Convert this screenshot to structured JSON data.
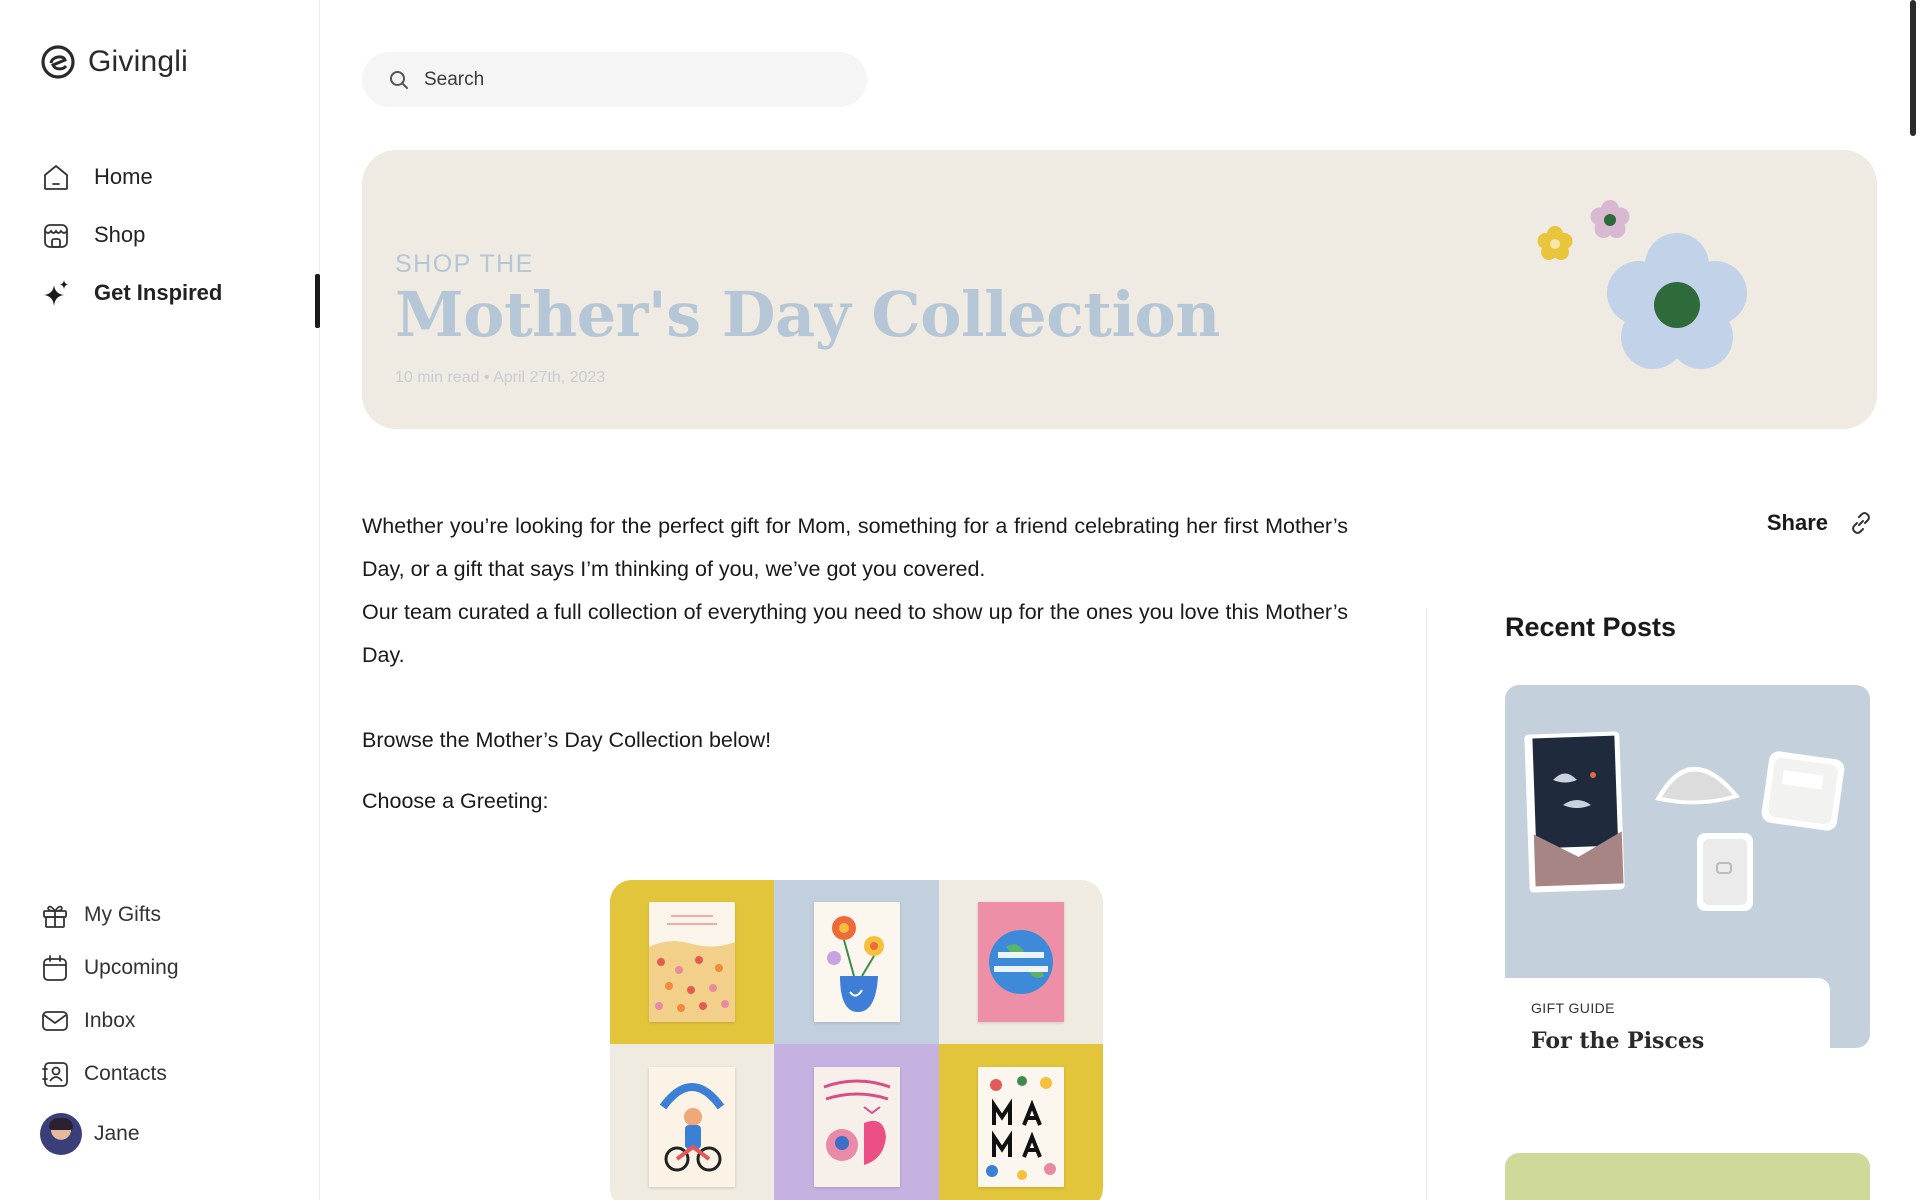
{
  "app": {
    "name": "Givingli"
  },
  "nav": {
    "items": [
      {
        "label": "Home",
        "icon": "home-icon"
      },
      {
        "label": "Shop",
        "icon": "shop-icon"
      },
      {
        "label": "Get Inspired",
        "icon": "sparkle-icon",
        "active": true
      }
    ]
  },
  "nav_bottom": {
    "items": [
      {
        "label": "My Gifts",
        "icon": "gift-icon"
      },
      {
        "label": "Upcoming",
        "icon": "calendar-icon"
      },
      {
        "label": "Inbox",
        "icon": "mail-icon"
      },
      {
        "label": "Contacts",
        "icon": "contacts-icon"
      }
    ]
  },
  "user": {
    "name": "Jane"
  },
  "search": {
    "placeholder": "Search"
  },
  "hero": {
    "kicker": "SHOP THE",
    "title": "Mother's Day Collection",
    "meta": "10 min read • April 27th, 2023"
  },
  "article": {
    "p1": "Whether you’re looking for the perfect gift for Mom, something for a friend celebrating her first Mother’s Day, or a gift that says I’m thinking of you, we’ve got you covered.",
    "p2": "Our team curated a full collection of everything you need to show up for the ones you love this Mother’s Day.",
    "p3": "Browse the Mother’s Day Collection below!",
    "p4": "Choose a Greeting:"
  },
  "share": {
    "label": "Share"
  },
  "recent": {
    "title": "Recent Posts",
    "posts": [
      {
        "tag": "GIFT GUIDE",
        "title": "For the Pisces"
      }
    ]
  },
  "greetings": {
    "tiles": [
      {
        "bg": "#e3c53c",
        "card": "flower-field-card"
      },
      {
        "bg": "#c1d0dc",
        "card": "for-you-vase-card"
      },
      {
        "bg": "#efebe1",
        "card": "best-mom-in-the-world-card"
      },
      {
        "bg": "#efebe1",
        "card": "coolest-mom-card"
      },
      {
        "bg": "#c6b2e0",
        "card": "happy-first-mothers-day-card"
      },
      {
        "bg": "#e3c53c",
        "card": "mama-card"
      }
    ]
  },
  "colors": {
    "accent": "#1a1a1a",
    "hero_bg": "#efebe3",
    "hero_text": "#b5c6d6"
  }
}
